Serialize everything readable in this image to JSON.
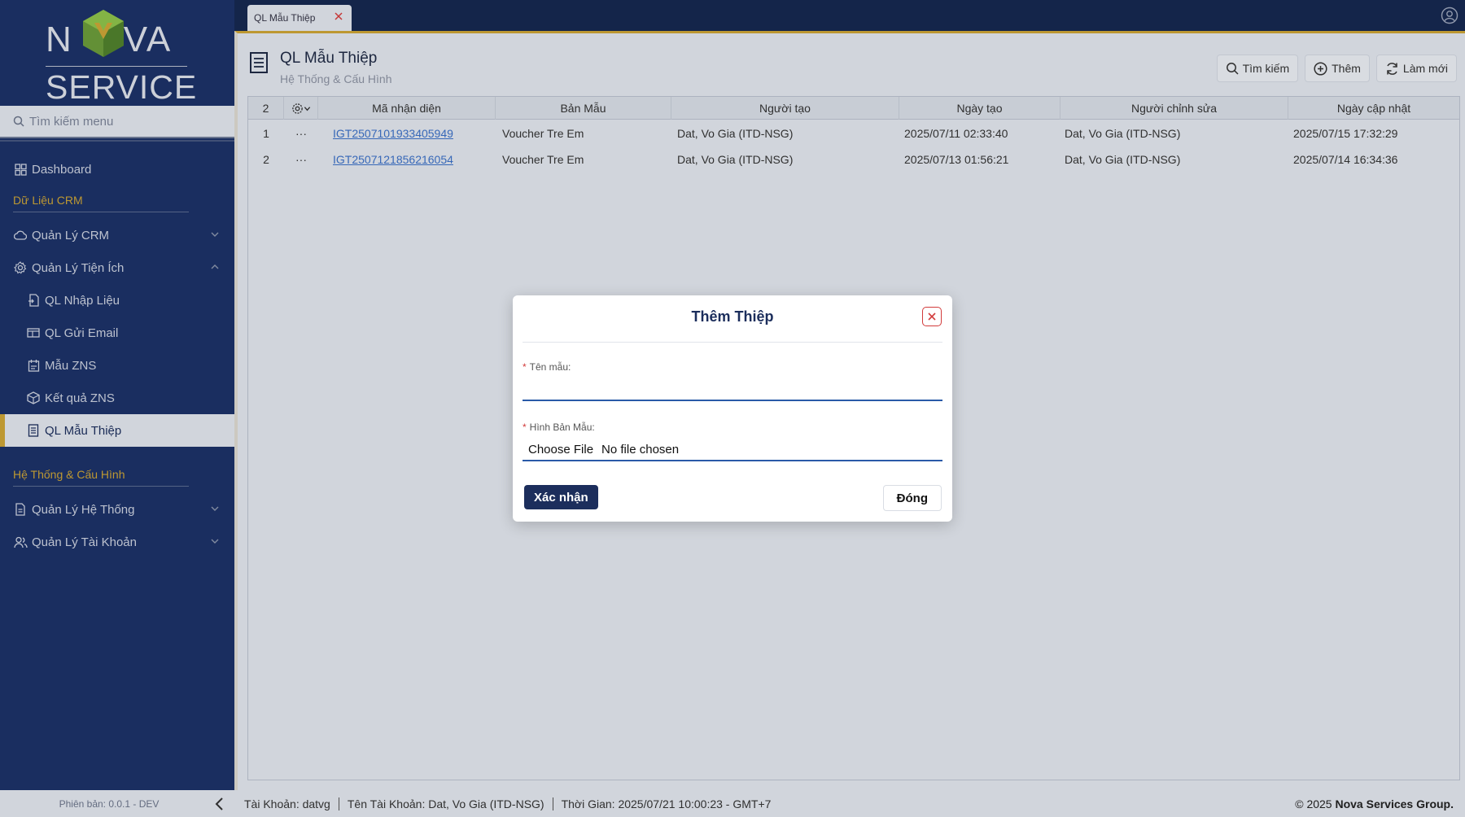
{
  "logo": {
    "line1_left": "N",
    "line1_right": "VA",
    "line2": "SERVICE"
  },
  "sidebar": {
    "search_placeholder": "Tìm kiếm menu",
    "dashboard": "Dashboard",
    "section_crm": "Dữ Liệu CRM",
    "crm_manage": "Quản Lý CRM",
    "utility_manage": "Quản Lý Tiện Ích",
    "sub_items": [
      "QL Nhập Liệu",
      "QL Gửi Email",
      "Mẫu ZNS",
      "Kết quả ZNS",
      "QL Mẫu Thiệp"
    ],
    "section_system": "Hệ Thống & Cấu Hình",
    "system_manage": "Quản Lý Hệ Thống",
    "account_manage": "Quản Lý Tài Khoản",
    "version": "Phiên bản: 0.0.1 - DEV"
  },
  "tabs": [
    {
      "label": "QL Mẫu Thiệp"
    }
  ],
  "page": {
    "title": "QL Mẫu Thiệp",
    "subtitle": "Hệ Thống & Cấu Hình",
    "actions": {
      "search": "Tìm kiếm",
      "add": "Thêm",
      "refresh": "Làm mới"
    }
  },
  "table": {
    "count": "2",
    "columns": [
      "Mã nhận diện",
      "Bản Mẫu",
      "Người tạo",
      "Ngày tạo",
      "Người chỉnh sửa",
      "Ngày cập nhật"
    ],
    "rows": [
      {
        "no": "1",
        "menu": "···",
        "code": "IGT2507101933405949",
        "template": "Voucher Tre Em",
        "creator": "Dat, Vo Gia (ITD-NSG)",
        "created": "2025/07/11 02:33:40",
        "editor": "Dat, Vo Gia (ITD-NSG)",
        "updated": "2025/07/15 17:32:29"
      },
      {
        "no": "2",
        "menu": "···",
        "code": "IGT2507121856216054",
        "template": "Voucher Tre Em",
        "creator": "Dat, Vo Gia (ITD-NSG)",
        "created": "2025/07/13 01:56:21",
        "editor": "Dat, Vo Gia (ITD-NSG)",
        "updated": "2025/07/14 16:34:36"
      }
    ]
  },
  "modal": {
    "title": "Thêm Thiệp",
    "field_name_label": "Tên mẫu:",
    "field_name_value": "",
    "field_file_label": "Hình Bản Mẫu:",
    "choose_file": "Choose File",
    "no_file": "No file chosen",
    "required_mark": "*",
    "confirm": "Xác nhận",
    "close": "Đóng"
  },
  "footer": {
    "account": "Tài Khoản: datvg",
    "account_name": "Tên Tài Khoản: Dat, Vo Gia (ITD-NSG)",
    "time": "Thời Gian: 2025/07/21 10:00:23 - GMT+7",
    "copy_prefix": "© 2025",
    "copy_company": "Nova Services Group."
  },
  "colors": {
    "sidebar": "#1c3166",
    "accent": "#c9a236",
    "primary": "#1c2e5c",
    "link": "#3b6fc4",
    "danger": "#d23b3b"
  }
}
